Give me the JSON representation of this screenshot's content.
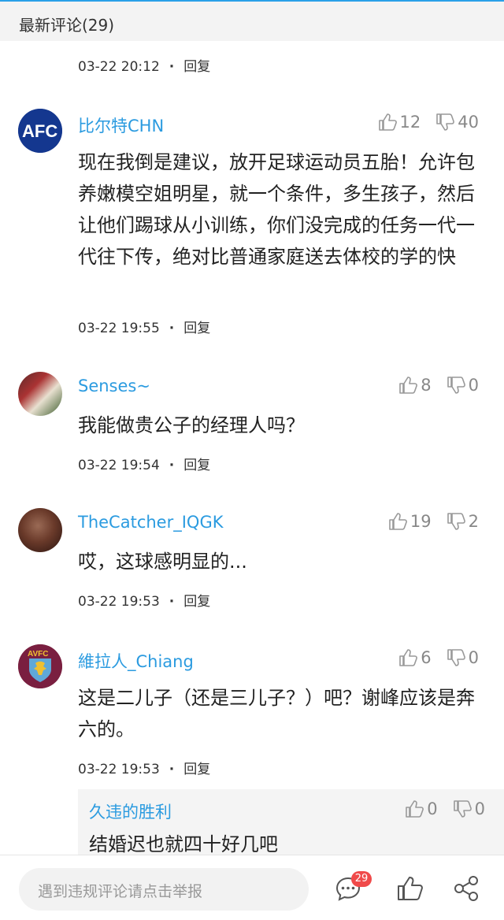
{
  "header": {
    "title": "最新评论(29)"
  },
  "comments": [
    {
      "time": "03-22 20:12",
      "reply_label": "回复"
    },
    {
      "username": "比尔特CHN",
      "likes": "12",
      "dislikes": "40",
      "text": "现在我倒是建议，放开足球运动员五胎！允许包养嫩模空姐明星，就一个条件，多生孩子，然后让他们踢球从小训练，你们没完成的任务一代一代往下传，绝对比普通家庭送去体校的学的快",
      "time": "03-22 19:55",
      "reply_label": "回复"
    },
    {
      "username": "Senses~",
      "likes": "8",
      "dislikes": "0",
      "text": "我能做贵公子的经理人吗？",
      "time": "03-22 19:54",
      "reply_label": "回复"
    },
    {
      "username": "TheCatcher_IQGK",
      "likes": "19",
      "dislikes": "2",
      "text": "哎，这球感明显的...",
      "time": "03-22 19:53",
      "reply_label": "回复"
    },
    {
      "username": "維拉人_Chiang",
      "likes": "6",
      "dislikes": "0",
      "text": "这是二儿子（还是三儿子？）吧？谢峰应该是奔六的。",
      "time": "03-22 19:53",
      "reply_label": "回复",
      "reply": {
        "username": "久违的胜利",
        "likes": "0",
        "dislikes": "0",
        "text": "结婚迟也就四十好几吧"
      }
    }
  ],
  "avatars": {
    "afc_logo_text": "AFC",
    "avfc_crest_text": "AVFC"
  },
  "bottom_bar": {
    "input_placeholder": "遇到违规评论请点击举报",
    "comment_count_badge": "29"
  },
  "colors": {
    "accent": "#2b9be0",
    "badge": "#f04a4a"
  }
}
